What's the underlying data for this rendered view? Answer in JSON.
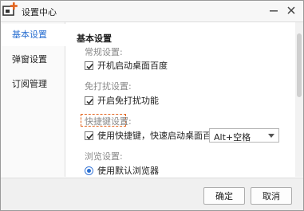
{
  "window": {
    "title": "设置中心"
  },
  "sidebar": {
    "items": [
      {
        "label": "基本设置",
        "active": true
      },
      {
        "label": "弹窗设置",
        "active": false
      },
      {
        "label": "订阅管理",
        "active": false
      }
    ]
  },
  "content": {
    "section_title": "基本设置",
    "groups": {
      "startup": {
        "label": "常规设置:",
        "option": "开机启动桌面百度"
      },
      "nodisturb": {
        "label": "免打扰设置:",
        "option": "开启免打扰功能"
      },
      "hotkey": {
        "label": "快捷键设置:",
        "option": "使用快捷键，快速启动桌面百度",
        "value": "Alt+空格"
      },
      "browser": {
        "label": "浏览设置:",
        "option": "使用默认浏览器"
      }
    }
  },
  "footer": {
    "ok_label": "确定",
    "cancel_label": "取消"
  },
  "colors": {
    "accent": "#2a6fd1",
    "highlight": "#e3641e"
  }
}
